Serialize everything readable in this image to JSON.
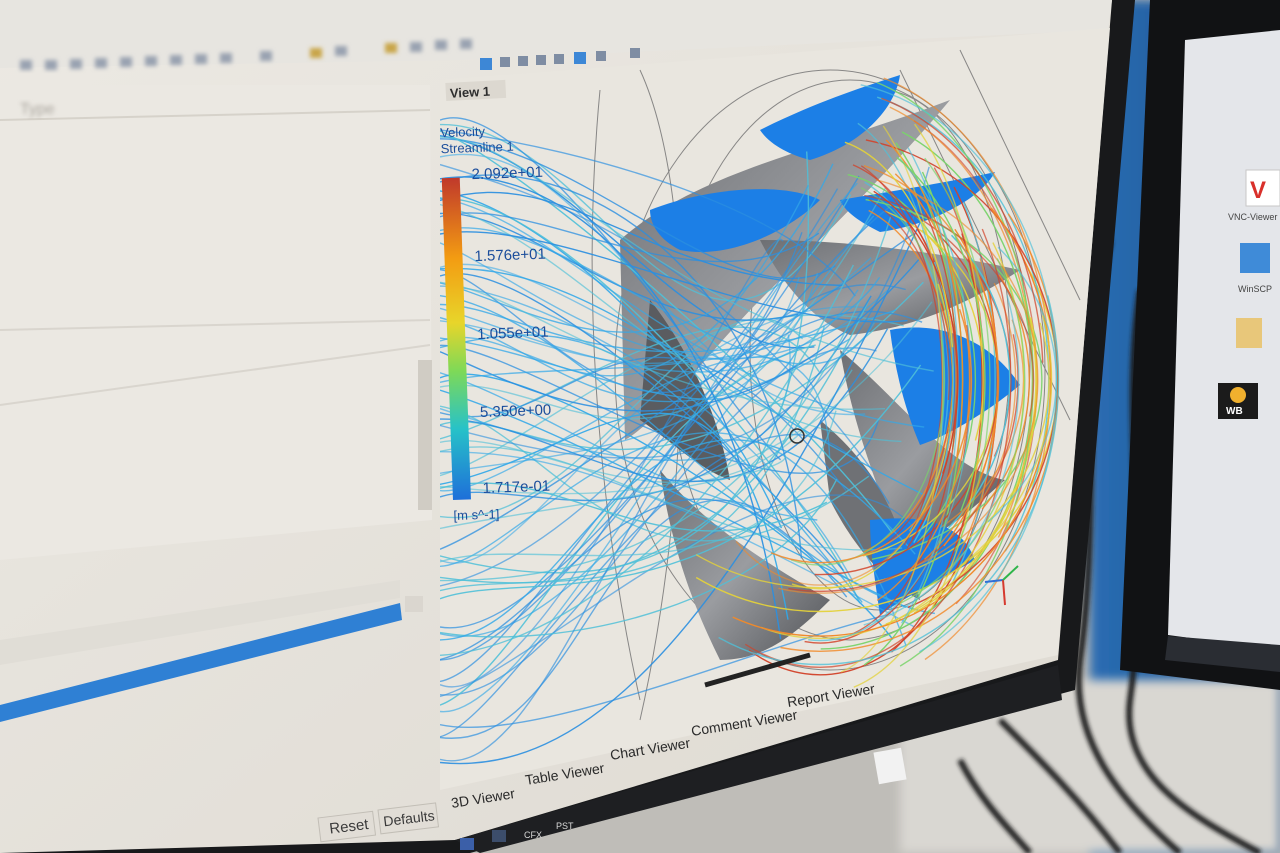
{
  "viewport_tab": "View 1",
  "colorbar": {
    "variable": "Velocity",
    "object": "Streamline 1",
    "max": "2.092e+01",
    "t1": "1.576e+01",
    "t2": "1.055e+01",
    "t3": "5.350e+00",
    "min": "1.717e-01",
    "unit": "[m s^-1]",
    "colors": [
      "#c0392b",
      "#f39c12",
      "#f1c40f",
      "#7ed957",
      "#27c2c8",
      "#1e6fd9"
    ]
  },
  "left_panel": {
    "header": "Type",
    "reset_button": "Reset",
    "defaults_button": "Defaults"
  },
  "bottom_tabs": [
    "3D Viewer",
    "Table Viewer",
    "Chart Viewer",
    "Comment Viewer",
    "Report Viewer"
  ],
  "desktop_icons": [
    {
      "label": "VNC-Viewer",
      "icon": "vnc-icon"
    },
    {
      "label": "WinSCP",
      "icon": "winscp-icon"
    },
    {
      "label": "",
      "icon": "folder-icon"
    },
    {
      "label": "WB",
      "icon": "workbench-icon"
    }
  ],
  "taskbar_apps": [
    "CFX",
    "PST"
  ],
  "streamline_colors": [
    "#2b8fe0",
    "#33a8e8",
    "#4fc0d8",
    "#7ad36b",
    "#e3d13a",
    "#f08a2a",
    "#d1432a"
  ]
}
